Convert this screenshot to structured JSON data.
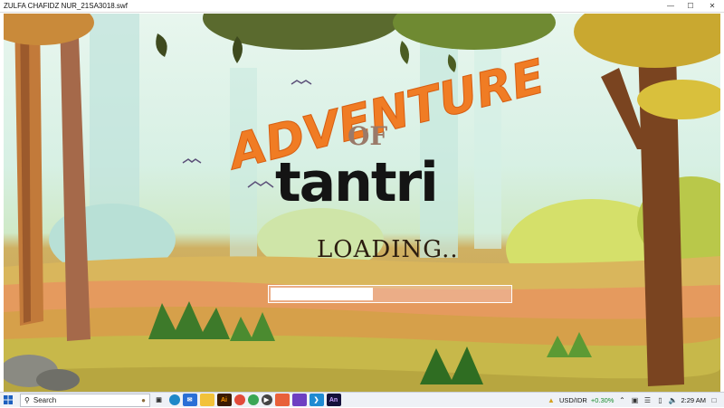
{
  "window": {
    "title": "ZULFA CHAFIDZ NUR_21SA3018.swf",
    "minimize_icon": "minimize-icon",
    "maximize_icon": "maximize-icon",
    "close_icon": "close-icon"
  },
  "game": {
    "title_line1": "ADVENTURE",
    "title_line2": "OF",
    "title_line3": "tantri",
    "loading_text": "LOADING..",
    "loading_progress": 0.42
  },
  "taskbar": {
    "search_placeholder": "Search",
    "pinned_apps": [
      "task-view-icon",
      "edge-icon",
      "mail-icon",
      "file-explorer-icon",
      "illustrator-icon",
      "chrome-icon",
      "chrome-profile-icon",
      "media-player-icon",
      "image-viewer-icon",
      "photos-icon",
      "vscode-icon",
      "animate-icon"
    ],
    "tray": {
      "currency": "USD/IDR",
      "currency_change": "+0.30%",
      "time": "2:29 AM"
    }
  },
  "colors": {
    "title_orange": "#f07c24",
    "of_color": "#9a7a69",
    "tantri_color": "#141414",
    "loading_color": "#2c1d10"
  }
}
